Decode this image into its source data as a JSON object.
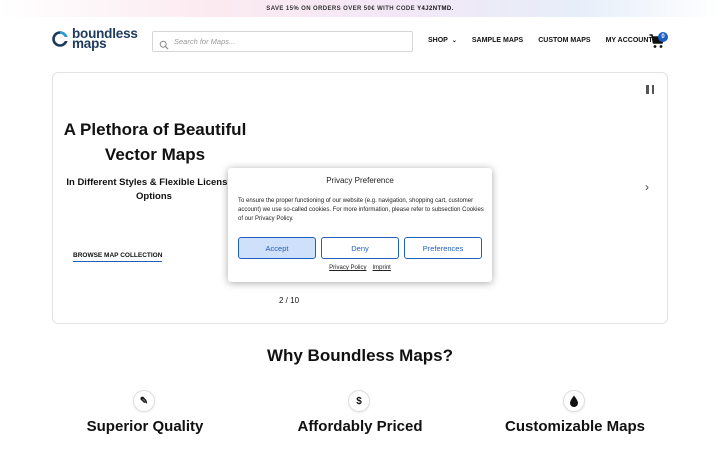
{
  "promo": {
    "text": "SAVE 15% ON ORDERS OVER 50€ WITH CODE ",
    "code": "Y4J2NTMD."
  },
  "header": {
    "logo_line1": "boundless",
    "logo_line2": "maps",
    "search_placeholder": "Search for Maps...",
    "nav": [
      {
        "label": "SHOP",
        "has_dropdown": true
      },
      {
        "label": "SAMPLE MAPS"
      },
      {
        "label": "CUSTOM MAPS"
      },
      {
        "label": "MY ACCOUNT"
      }
    ],
    "cart_count": "0",
    "icons": {
      "search": "search-icon",
      "cart": "cart-icon",
      "dropdown": "chevron-down-icon"
    }
  },
  "hero": {
    "title": "A Plethora of Beautiful Vector Maps",
    "subtitle": "In Different Styles & Flexible Licensing Options",
    "cta": "BROWSE MAP COLLECTION",
    "counter": "2 / 10",
    "next_glyph": "›"
  },
  "privacy": {
    "title": "Privacy Preference",
    "text": "To ensure the proper functioning of our website (e.g. navigation, shopping cart, customer account) we use so-called cookies. For more information, please refer to subsection Cookies of our Privacy Policy.",
    "accept": "Accept",
    "deny": "Deny",
    "preferences": "Preferences",
    "link_policy": "Privacy Policy",
    "link_imprint": "Imprint"
  },
  "why": {
    "title": "Why Boundless Maps?",
    "features": [
      {
        "title": "Superior Quality",
        "icon": "pencil-icon",
        "glyph": "✎"
      },
      {
        "title": "Affordably Priced",
        "icon": "dollar-icon",
        "glyph": "$"
      },
      {
        "title": "Customizable Maps",
        "icon": "drop-icon",
        "glyph": "●"
      }
    ]
  },
  "colors": {
    "accent": "#1e5fc4",
    "brand": "#1e3a5f"
  }
}
